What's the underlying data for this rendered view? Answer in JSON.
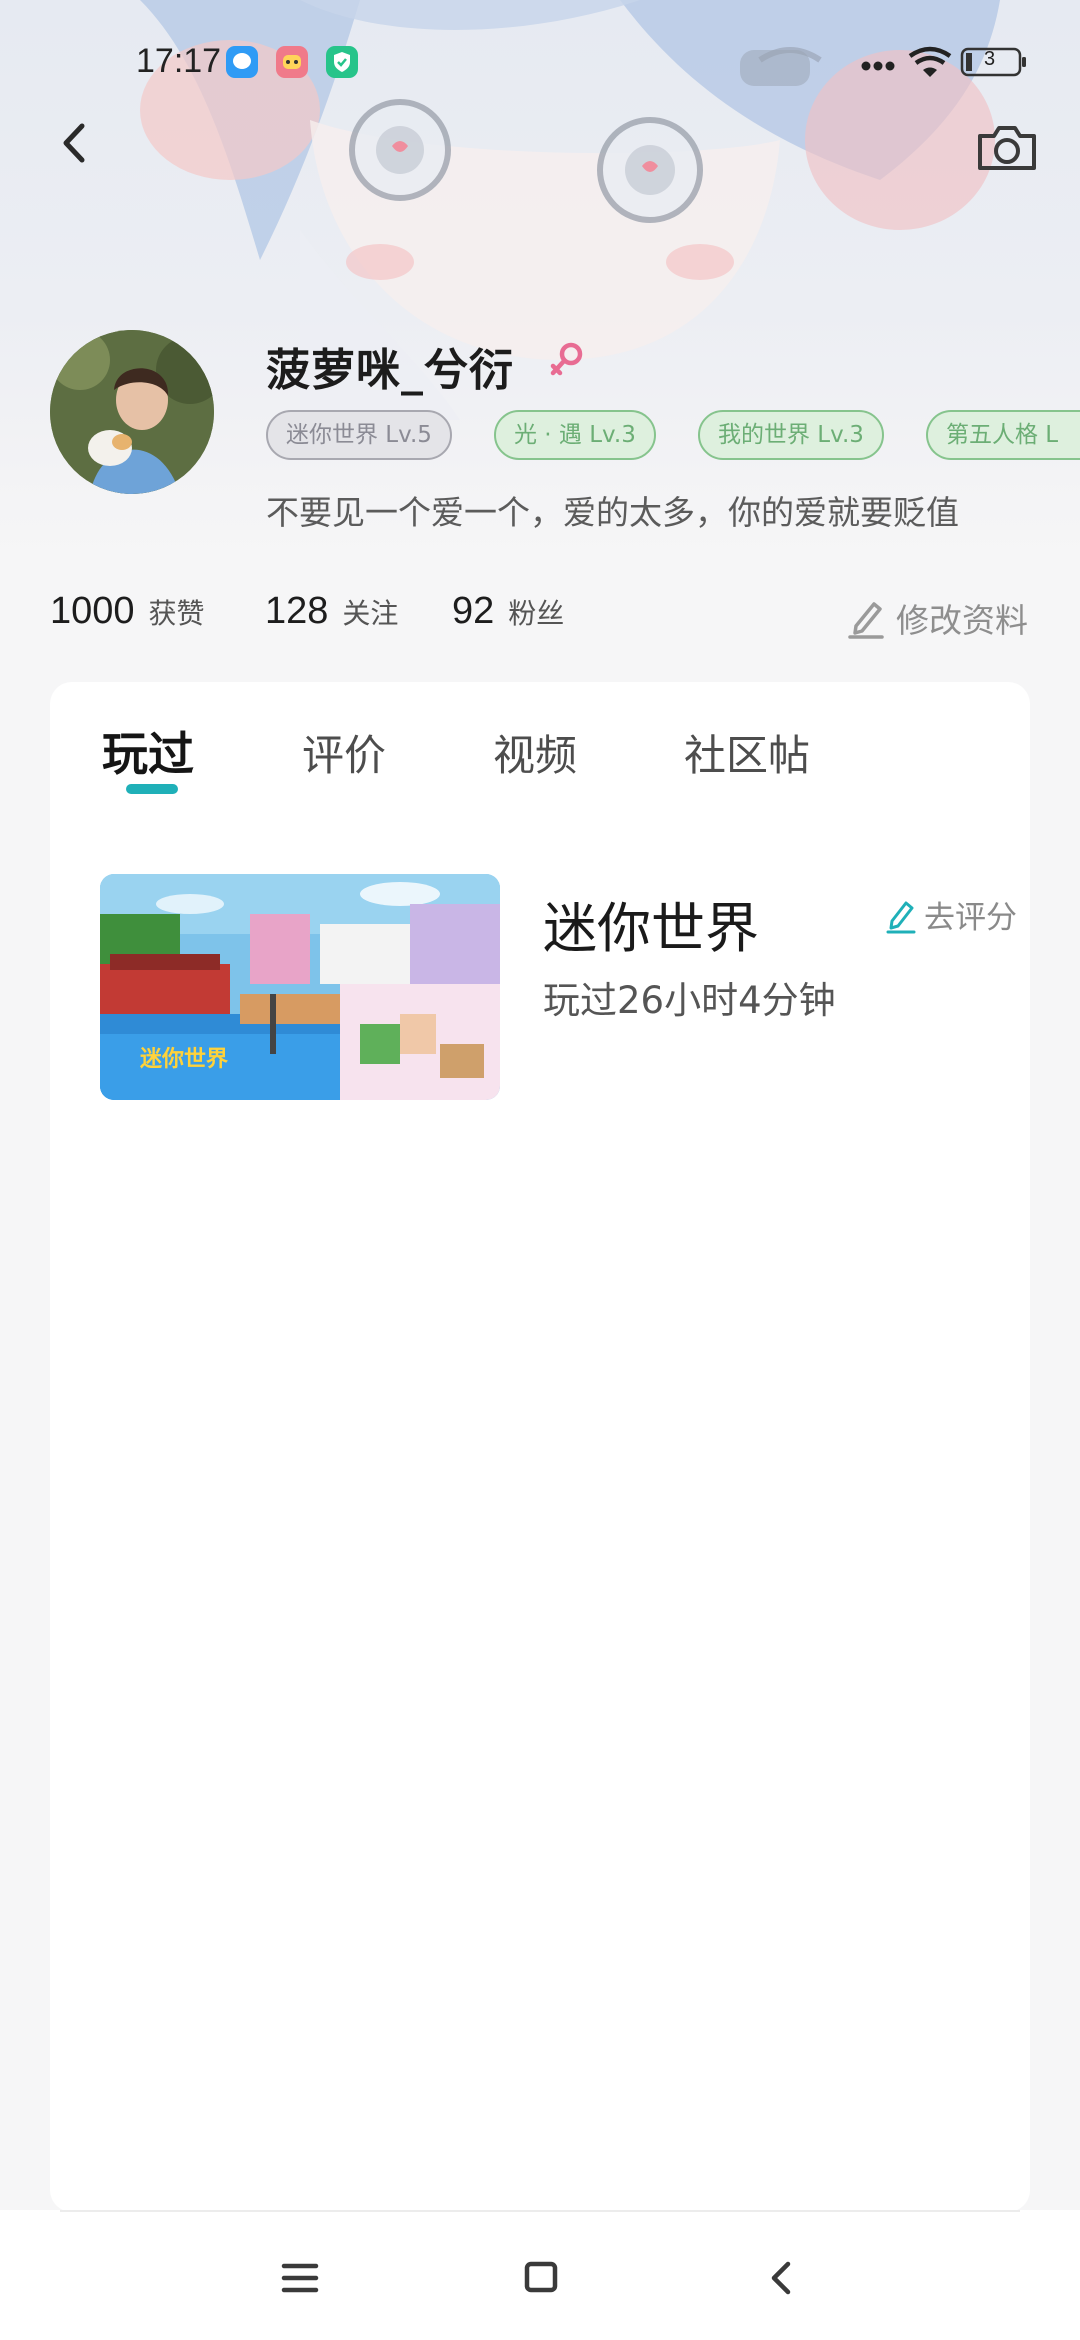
{
  "status_bar": {
    "time": "17:17",
    "app_icons": [
      {
        "name": "message-bubble-icon",
        "color": "#2f9bf5"
      },
      {
        "name": "game-center-icon",
        "color": "#f07a8a"
      },
      {
        "name": "shield-check-icon",
        "color": "#27c48a"
      }
    ],
    "battery_level": "3"
  },
  "header": {
    "back_icon": "chevron-left-icon",
    "camera_icon": "camera-icon"
  },
  "profile": {
    "username": "菠萝咪_兮衍",
    "gender_icon": "female-icon",
    "gender_color": "#e86c93",
    "tags": [
      {
        "label": "迷你世界 Lv.5",
        "style": "grey"
      },
      {
        "label": "光 · 遇 Lv.3",
        "style": "green"
      },
      {
        "label": "我的世界 Lv.3",
        "style": "green"
      },
      {
        "label": "第五人格 L",
        "style": "green"
      }
    ],
    "bio": "不要见一个爱一个，爱的太多，你的爱就要贬值"
  },
  "stats": {
    "likes_count": "1000",
    "likes_label": "获赞",
    "following_count": "128",
    "following_label": "关注",
    "followers_count": "92",
    "followers_label": "粉丝",
    "edit_label": "修改资料"
  },
  "tabs": [
    {
      "label": "玩过",
      "active": true
    },
    {
      "label": "评价",
      "active": false
    },
    {
      "label": "视频",
      "active": false
    },
    {
      "label": "社区帖",
      "active": false
    }
  ],
  "accent_color": "#1fb0b8",
  "games": [
    {
      "title": "迷你世界",
      "rate_label": "去评分",
      "playtime": "玩过26小时4分钟"
    }
  ],
  "nav_bar": {
    "menu_icon": "menu-icon",
    "home_icon": "home-square-icon",
    "back_icon": "back-triangle-icon"
  }
}
